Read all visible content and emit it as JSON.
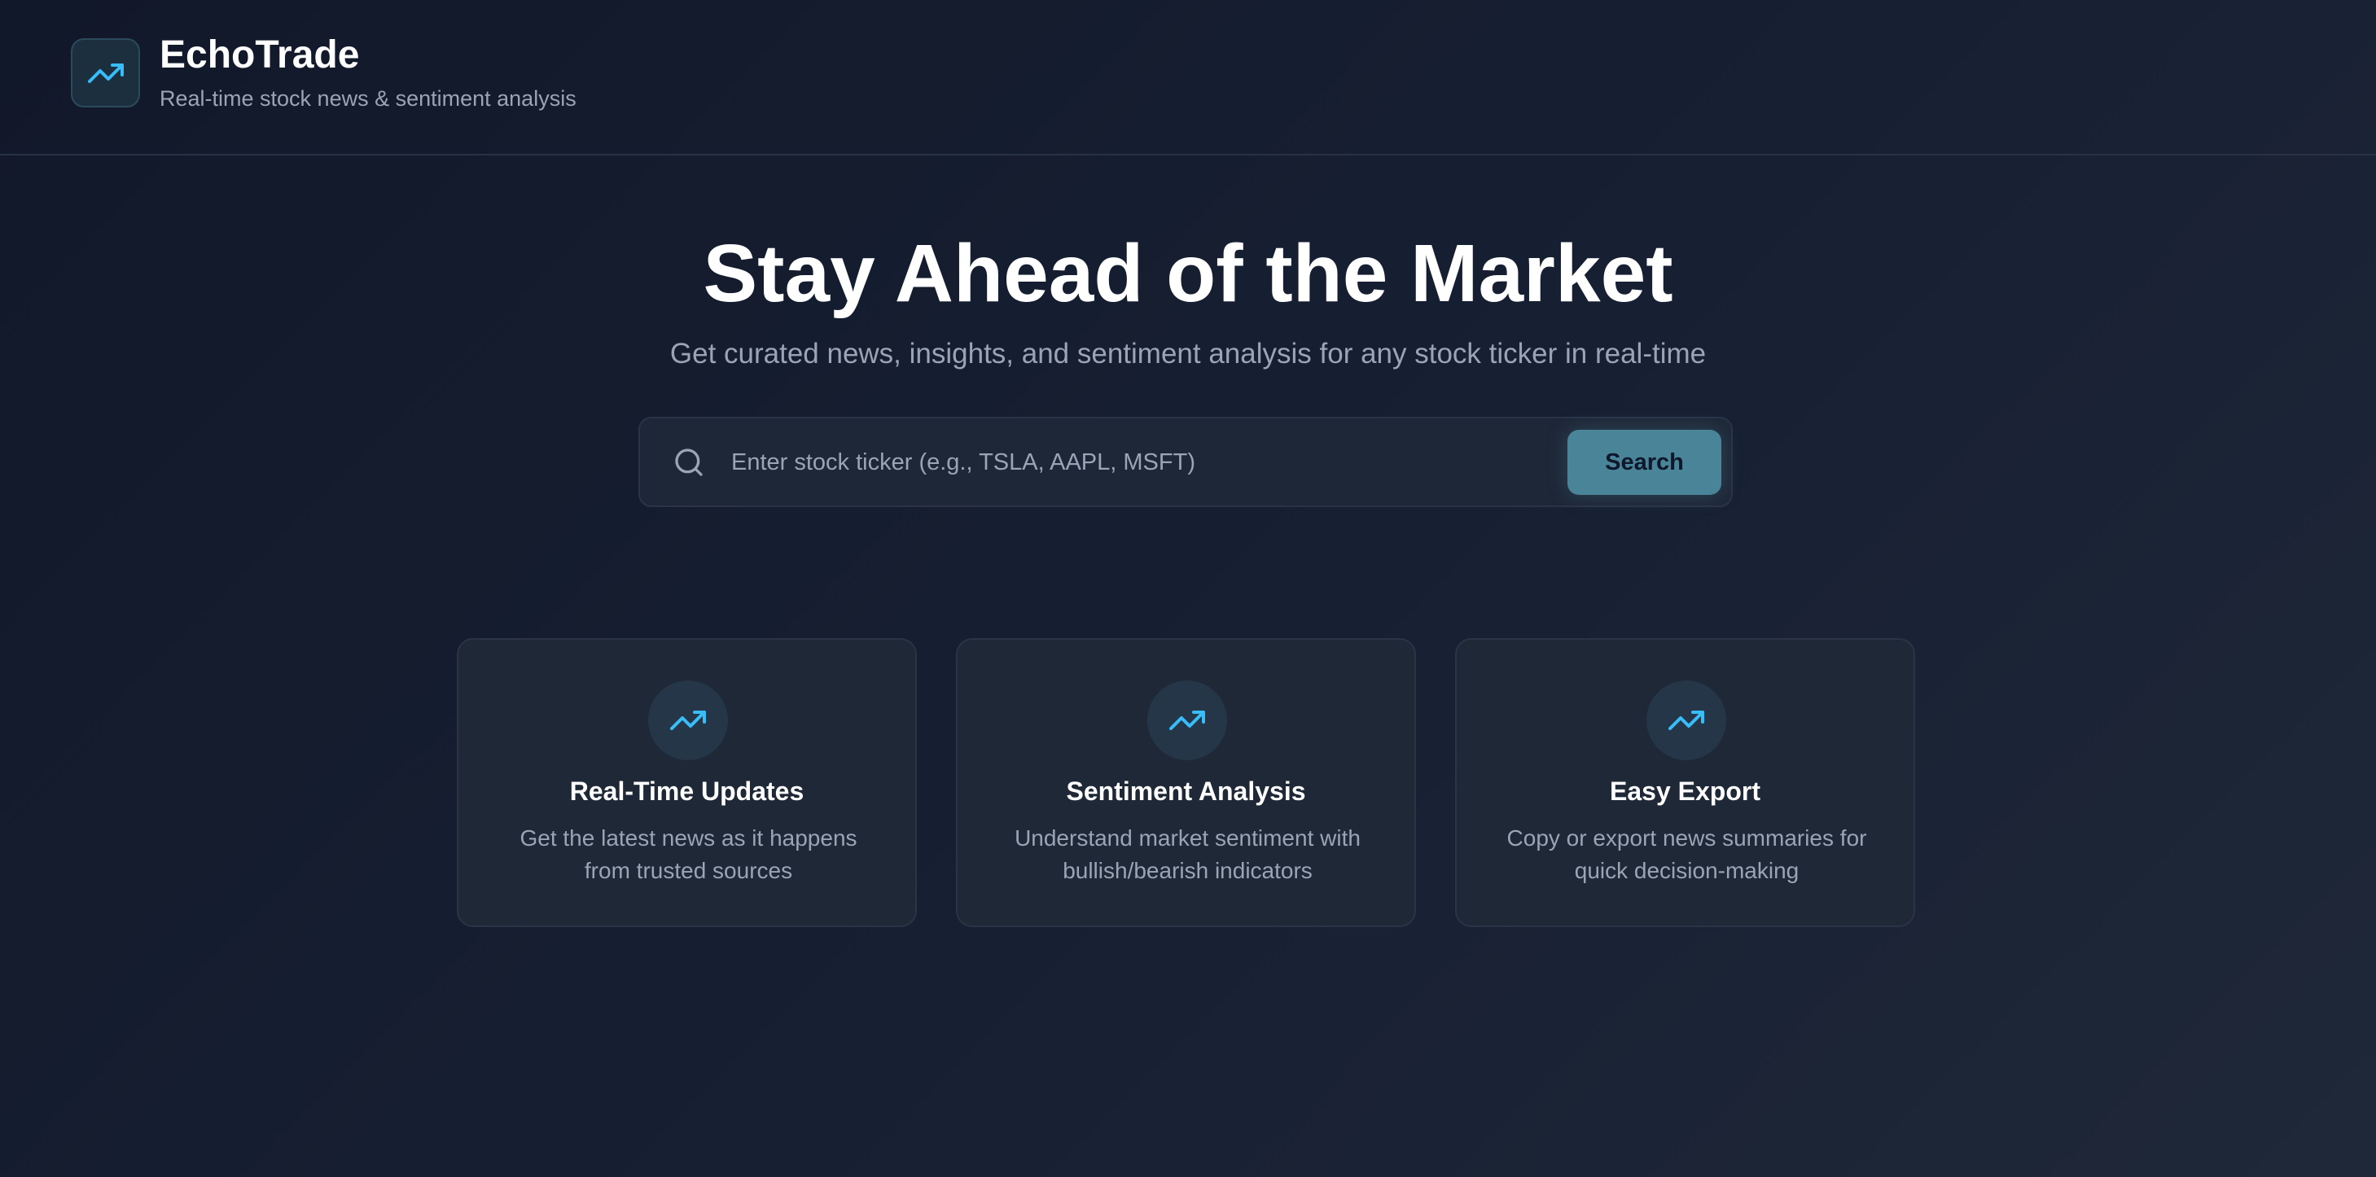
{
  "colors": {
    "accent": "#38bdf8",
    "button": "#4a8499",
    "background": "#111829",
    "card": "#1f2837",
    "muted_text": "#9aa4b5"
  },
  "header": {
    "logo_icon": "trending-up-icon",
    "title": "EchoTrade",
    "subtitle": "Real-time stock news & sentiment analysis"
  },
  "hero": {
    "title": "Stay Ahead of the Market",
    "subtitle": "Get curated news, insights, and sentiment analysis for any stock ticker in real-time"
  },
  "search": {
    "icon": "search-icon",
    "value": "",
    "placeholder": "Enter stock ticker (e.g., TSLA, AAPL, MSFT)",
    "button_label": "Search"
  },
  "features": [
    {
      "icon": "trending-up-icon",
      "title": "Real-Time Updates",
      "desc_line1": "Get the latest news as it happens",
      "desc_line2": "from trusted sources"
    },
    {
      "icon": "trending-up-icon",
      "title": "Sentiment Analysis",
      "desc_line1": "Understand market sentiment with",
      "desc_line2": "bullish/bearish indicators"
    },
    {
      "icon": "trending-up-icon",
      "title": "Easy Export",
      "desc_line1": "Copy or export news summaries for",
      "desc_line2": "quick decision-making"
    }
  ]
}
